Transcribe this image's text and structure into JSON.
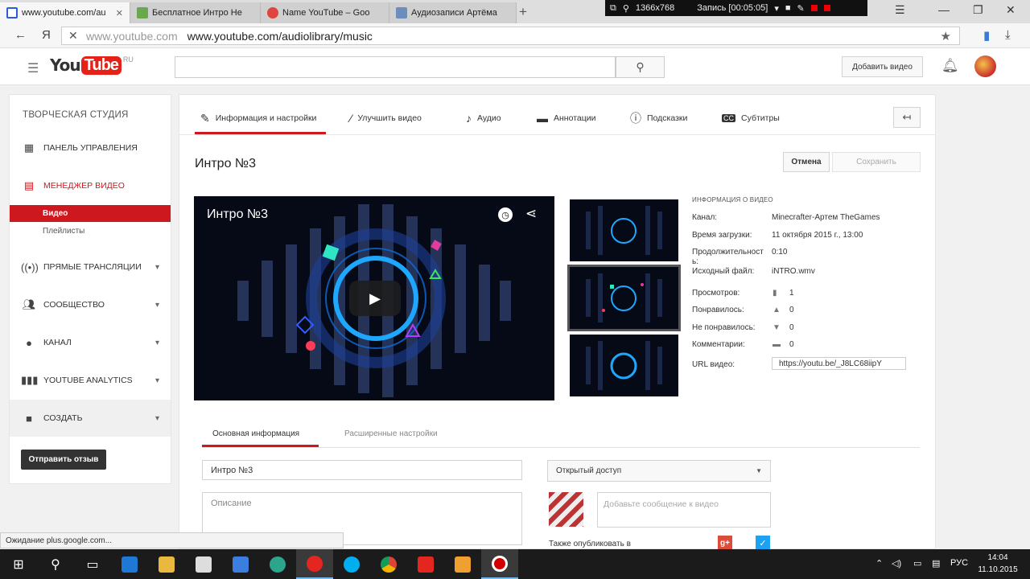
{
  "browser": {
    "tabs": [
      {
        "title": "www.youtube.com/au",
        "favicon_color": "#2b5cd9",
        "active": true
      },
      {
        "title": "Бесплатное Интро Не",
        "favicon_color": "#6aa84f",
        "active": false
      },
      {
        "title": "Name YouTube – Goo",
        "favicon_color": "#e0443e",
        "active": false
      },
      {
        "title": "Аудиозаписи Артёма",
        "favicon_color": "#6c8ebf",
        "active": false
      }
    ],
    "new_tab": "+",
    "recorder": {
      "resolution": "1366x768",
      "label": "Запись [00:05:05]"
    },
    "url_host": "www.youtube.com",
    "url_full": "www.youtube.com/audiolibrary/music",
    "yandex": "Я"
  },
  "header": {
    "logo_you": "You",
    "logo_tube": "Tube",
    "logo_region": "RU",
    "search_value": "",
    "upload_label": "Добавить видео"
  },
  "sidebar": {
    "title": "ТВОРЧЕСКАЯ СТУДИЯ",
    "items": [
      {
        "label": "ПАНЕЛЬ УПРАВЛЕНИЯ",
        "icon": "dashboard-icon"
      },
      {
        "label": "МЕНЕДЖЕР ВИДЕО",
        "icon": "video-manager-icon"
      },
      {
        "label": "ПРЯМЫЕ ТРАНСЛЯЦИИ",
        "icon": "live-icon"
      },
      {
        "label": "СООБЩЕСТВО",
        "icon": "community-icon"
      },
      {
        "label": "КАНАЛ",
        "icon": "channel-icon"
      },
      {
        "label": "YOUTUBE ANALYTICS",
        "icon": "analytics-icon"
      },
      {
        "label": "СОЗДАТЬ",
        "icon": "create-icon"
      }
    ],
    "sub_items": [
      "Видео",
      "Плейлисты"
    ],
    "feedback": "Отправить отзыв"
  },
  "main": {
    "tabs": [
      {
        "label": "Информация и настройки",
        "icon": "pencil-icon"
      },
      {
        "label": "Улучшить видео",
        "icon": "magic-wand-icon"
      },
      {
        "label": "Аудио",
        "icon": "music-note-icon"
      },
      {
        "label": "Аннотации",
        "icon": "annotation-icon"
      },
      {
        "label": "Подсказки",
        "icon": "info-icon"
      },
      {
        "label": "Субтитры",
        "icon": "cc-icon"
      }
    ],
    "video_title": "Интро №3",
    "cancel": "Отмена",
    "save": "Сохранить",
    "player_title": "Интро №3",
    "info": {
      "heading": "ИНФОРМАЦИЯ О ВИДЕО",
      "channel_label": "Канал:",
      "channel_value": "Minecrafter-Артем TheGames",
      "upload_label": "Время загрузки:",
      "upload_value": "11 октября 2015 г., 13:00",
      "duration_label_1": "Продолжительност",
      "duration_label_2": "ь:",
      "duration_value": "0:10",
      "file_label": "Исходный файл:",
      "file_value": "iNTRO.wmv",
      "views_label": "Просмотров:",
      "views_value": "1",
      "likes_label": "Понравилось:",
      "likes_value": "0",
      "dislikes_label": "Не понравилось:",
      "dislikes_value": "0",
      "comments_label": "Комментарии:",
      "comments_value": "0",
      "url_label": "URL видео:",
      "url_value": "https://youtu.be/_J8LC68iipY"
    },
    "subtabs": [
      "Основная информация",
      "Расширенные настройки"
    ],
    "title_field": "Интро №3",
    "description_placeholder": "Описание",
    "privacy": "Открытый доступ",
    "message_placeholder": "Добавьте сообщение к видео",
    "also_publish": "Также опубликовать в",
    "gplus": "g+"
  },
  "status": "Ожидание plus.google.com...",
  "taskbar": {
    "lang": "РУС",
    "time": "14:04",
    "date": "11.10.2015"
  }
}
